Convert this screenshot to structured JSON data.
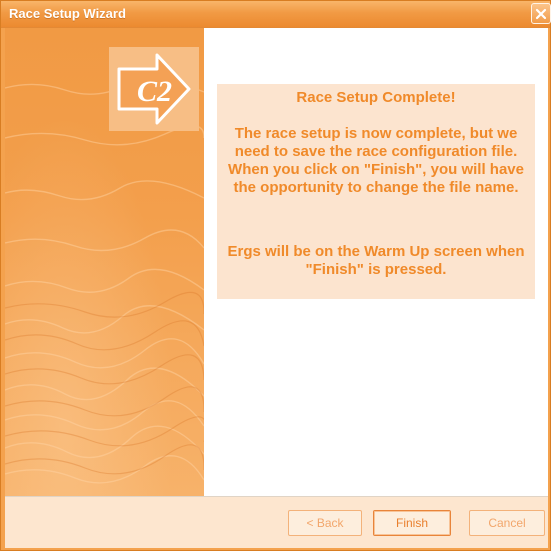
{
  "window": {
    "title": "Race Setup Wizard",
    "close_icon": "close-icon",
    "accent_color": "#f19a44"
  },
  "side_panel": {
    "logo_text": "C2",
    "logo_icon": "arrow-right-icon"
  },
  "message": {
    "heading": "Race Setup Complete!",
    "body": "The race setup is now complete, but we need to save the race configuration file.  When you click on \"Finish\", you will have the opportunity to change the file name.",
    "note": "Ergs will be on the Warm Up screen when \"Finish\" is pressed."
  },
  "buttons": {
    "back": "< Back",
    "finish": "Finish",
    "cancel": "Cancel"
  }
}
